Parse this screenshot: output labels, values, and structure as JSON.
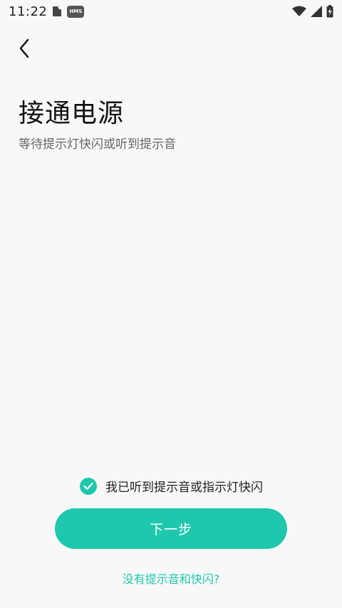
{
  "status_bar": {
    "time": "11:22",
    "hms_badge": "HMS",
    "icons": [
      "document-icon",
      "hms-icon",
      "wifi-icon",
      "signal-icon",
      "battery-charging-icon"
    ]
  },
  "header": {
    "back_icon": "chevron-left-icon"
  },
  "main": {
    "title": "接通电源",
    "subtitle": "等待提示灯快闪或听到提示音"
  },
  "confirm": {
    "checked": true,
    "label": "我已听到提示音或指示灯快闪",
    "icon": "check-circle-icon"
  },
  "actions": {
    "next_label": "下一步",
    "help_link": "没有提示音和快闪?"
  },
  "colors": {
    "accent": "#1fc8ad",
    "background": "#f8f8f8",
    "title": "#111111",
    "subtitle": "#666666"
  }
}
